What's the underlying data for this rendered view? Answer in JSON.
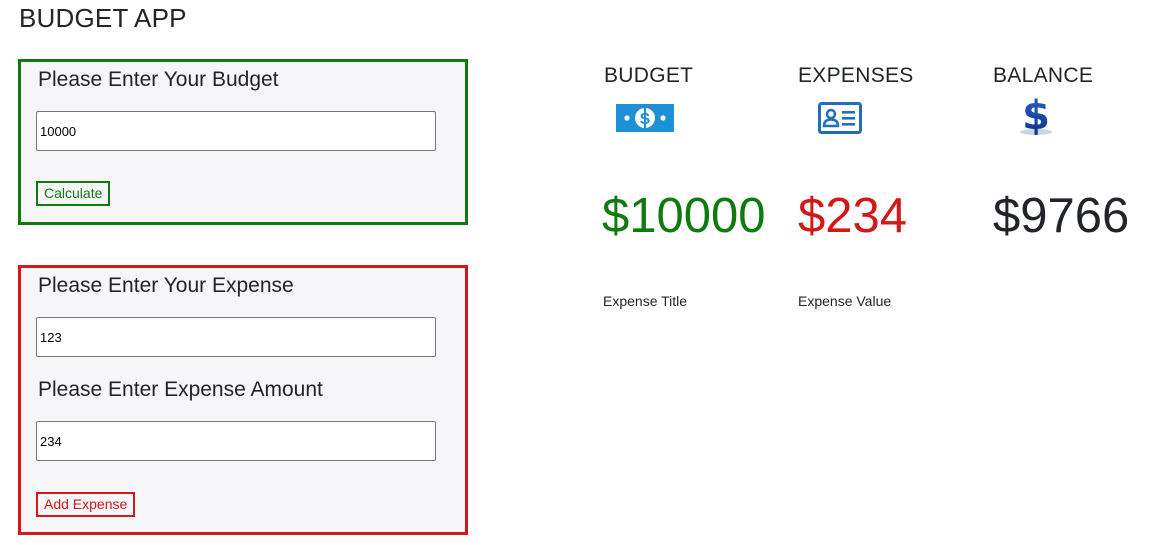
{
  "app": {
    "title": "BUDGET APP"
  },
  "budget_form": {
    "label": "Please Enter Your Budget",
    "input_value": "10000",
    "button_label": "Calculate"
  },
  "expense_form": {
    "title_label": "Please Enter Your Expense",
    "title_input_value": "123",
    "amount_label": "Please Enter Expense Amount",
    "amount_input_value": "234",
    "button_label": "Add Expense"
  },
  "summary": {
    "budget": {
      "heading": "BUDGET",
      "icon": "money-bill-icon",
      "amount": "$10000",
      "color": "#0f7b0f"
    },
    "expenses": {
      "heading": "EXPENSES",
      "icon": "id-card-icon",
      "amount": "$234",
      "color": "#d41717"
    },
    "balance": {
      "heading": "BALANCE",
      "icon": "dollar-sign-icon",
      "amount": "$9766",
      "color": "#212529"
    }
  },
  "expense_list": {
    "title_header": "Expense Title",
    "value_header": "Expense Value"
  },
  "colors": {
    "budget_accent": "#0f7b0f",
    "expense_accent": "#d41717",
    "icon_blue": "#1e90d6",
    "panel_bg": "#f6f5f8"
  }
}
